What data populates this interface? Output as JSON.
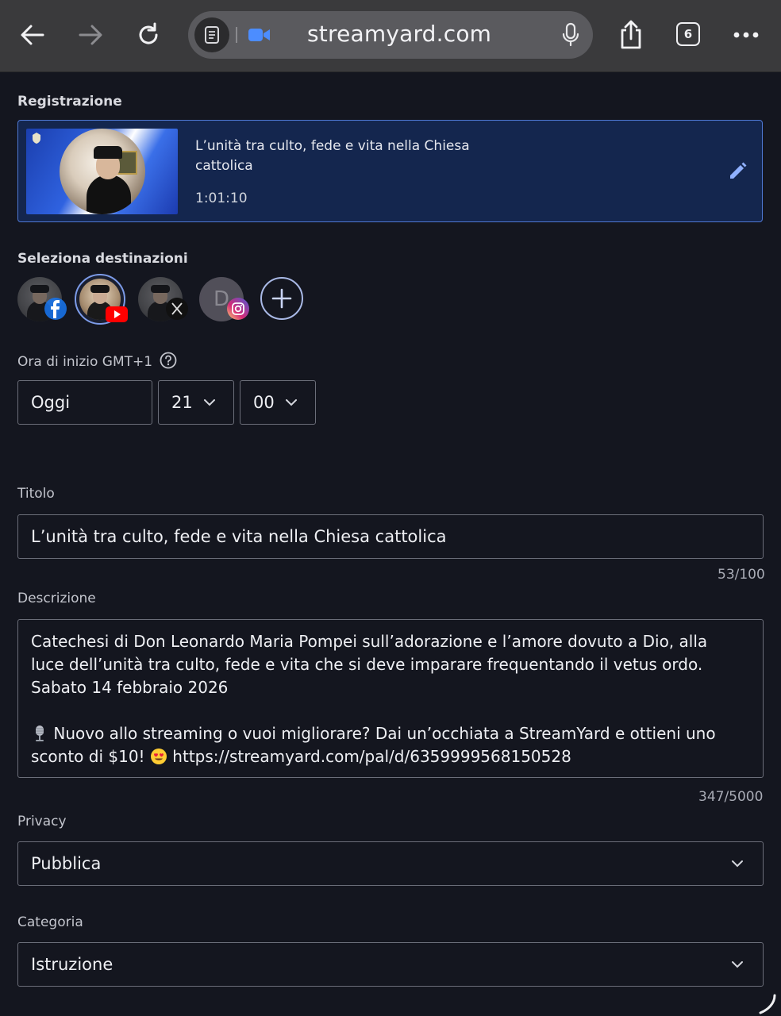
{
  "browser": {
    "url": "streamyard.com",
    "tab_count": "6"
  },
  "recording": {
    "section_label": "Registrazione",
    "title": "L’unità tra culto, fede e vita nella Chiesa cattolica",
    "duration": "1:01:10"
  },
  "destinations": {
    "label": "Seleziona destinazioni",
    "items": [
      {
        "platform": "facebook",
        "selected": false
      },
      {
        "platform": "youtube",
        "selected": true
      },
      {
        "platform": "x",
        "selected": false
      },
      {
        "platform": "instagram",
        "initial": "D",
        "selected": false
      }
    ]
  },
  "start_time": {
    "label": "Ora di inizio GMT+1",
    "day": "Oggi",
    "hour": "21",
    "minute": "00"
  },
  "title_field": {
    "label": "Titolo",
    "value": "L’unità tra culto, fede e vita nella Chiesa cattolica",
    "counter": "53/100"
  },
  "description": {
    "label": "Descrizione",
    "paragraph1": "Catechesi di Don Leonardo Maria Pompei sull’adorazione e l’amore dovuto a Dio, alla luce dell’unità tra culto, fede e vita che si deve imparare frequentando il vetus ordo. Sabato 14 febbraio 2026",
    "promo_text": "Nuovo allo streaming o vuoi migliorare? Dai un’occhiata a StreamYard e ottieni uno sconto di $10!",
    "promo_link": "https://streamyard.com/pal/d/6359999568150528",
    "counter": "347/5000"
  },
  "privacy": {
    "label": "Privacy",
    "value": "Pubblica"
  },
  "category": {
    "label": "Categoria",
    "value": "Istruzione"
  },
  "colors": {
    "background": "#14161f",
    "accent": "#4f78d3",
    "selected_card": "#14264e"
  }
}
